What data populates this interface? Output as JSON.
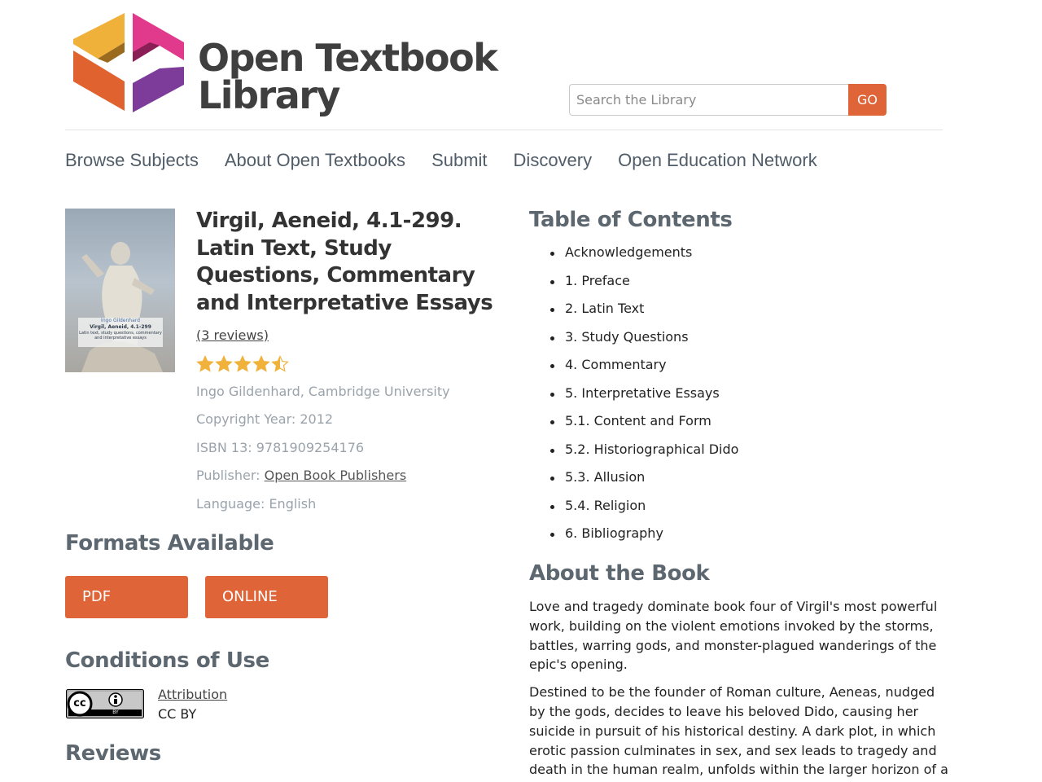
{
  "header": {
    "logo_line1": "Open Textbook",
    "logo_line2": "Library",
    "search_placeholder": "Search the Library",
    "search_button": "GO"
  },
  "nav": [
    "Browse Subjects",
    "About Open Textbooks",
    "Submit",
    "Discovery",
    "Open Education Network"
  ],
  "book": {
    "title": "Virgil, Aeneid, 4.1-299. Latin Text, Study Questions, Commentary and Interpretative Essays",
    "reviews": "(3 reviews)",
    "rating": 4.5,
    "rating_max": 5,
    "author": "Ingo Gildenhard, Cambridge University",
    "copyright": "Copyright Year: 2012",
    "isbn": "ISBN 13: 9781909254176",
    "publisher_label": "Publisher:",
    "publisher": "Open Book Publishers",
    "language": "Language: English",
    "cover_author": "Ingo Gildenhard",
    "cover_title": "Virgil, Aeneid, 4.1-299",
    "cover_subtitle": "Latin text, study questions, commentary and interpretative essays"
  },
  "formats": {
    "heading": "Formats Available",
    "buttons": [
      "PDF",
      "ONLINE"
    ]
  },
  "conditions": {
    "heading": "Conditions of Use",
    "link": "Attribution",
    "name": "CC BY",
    "badge_cc": "cc",
    "badge_by": "BY"
  },
  "reviews_heading": "Reviews",
  "toc": {
    "heading": "Table of Contents",
    "items": [
      "Acknowledgements",
      "1. Preface",
      "2. Latin Text",
      "3. Study Questions",
      "4. Commentary",
      "5. Interpretative Essays",
      "5.1. Content and Form",
      "5.2. Historiographical Dido",
      "5.3. Allusion",
      "5.4. Religion",
      "6. Bibliography"
    ]
  },
  "about": {
    "heading": "About the Book",
    "paragraphs": [
      "Love and tragedy dominate book four of Virgil's most powerful work, building on the violent emotions invoked by the storms, battles, warring gods, and monster-plagued wanderings of the epic's opening.",
      "Destined to be the founder of Roman culture, Aeneas, nudged by the gods, decides to leave his beloved Dido, causing her suicide in pursuit of his historical destiny. A dark plot, in which erotic passion culminates in sex, and sex leads to tragedy and death in the human realm, unfolds within the larger horizon of a"
    ]
  },
  "colors": {
    "accent": "#df6438",
    "heading": "#5d6770",
    "muted": "#9aa3ab",
    "star": "#f0b23b"
  }
}
